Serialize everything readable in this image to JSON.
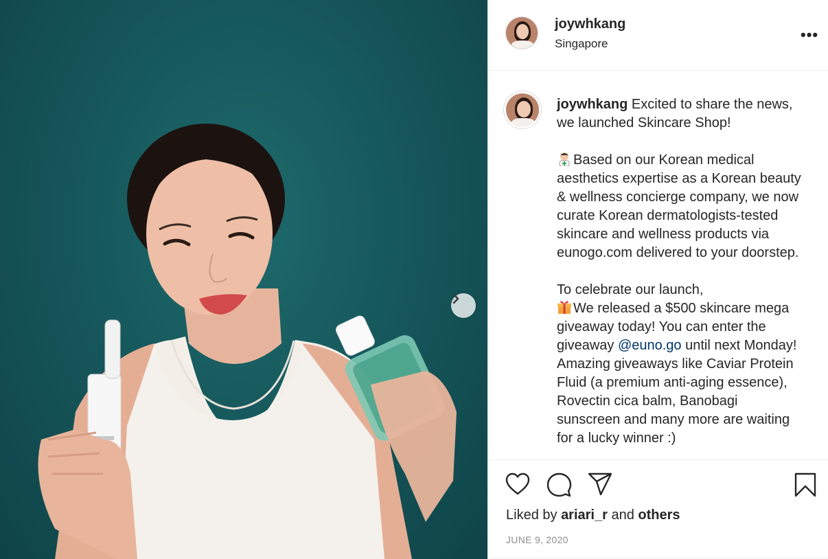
{
  "post": {
    "username": "joywhkang",
    "location": "Singapore",
    "more_label": "•••"
  },
  "caption": {
    "username": "joywhkang",
    "line1": "Excited to share the news, we launched Skincare Shop!",
    "para2": "Based on our Korean medical aesthetics expertise as a Korean beauty & wellness concierge company, we now curate Korean dermatologists-tested skincare and wellness products via eunogo.com delivered to your doorstep.",
    "para3_line1": "To celebrate our launch,",
    "para3_a": "We released a $500 skincare mega giveaway today! You can enter the giveaway ",
    "mention": "@euno.go",
    "para3_b": " until next Monday! Amazing giveaways like Caviar Protein Fluid (a premium anti-aging essence), Rovectin cica balm, Banobagi sunscreen and many more are waiting for a lucky winner :)"
  },
  "engagement": {
    "liked_by_prefix": "Liked by",
    "liked_by_user": "ariari_r",
    "liked_by_and": "and",
    "liked_by_others": "others",
    "date": "JUNE 9, 2020"
  },
  "icons": {
    "like": "heart-icon",
    "comment": "comment-icon",
    "share": "paper-plane-icon",
    "save": "bookmark-icon",
    "next": "chevron-right-icon"
  },
  "colors": {
    "background_teal": "#16585c",
    "text": "#262626",
    "mention": "#00376b",
    "muted": "#8e8e8e",
    "divider": "#efefef"
  }
}
